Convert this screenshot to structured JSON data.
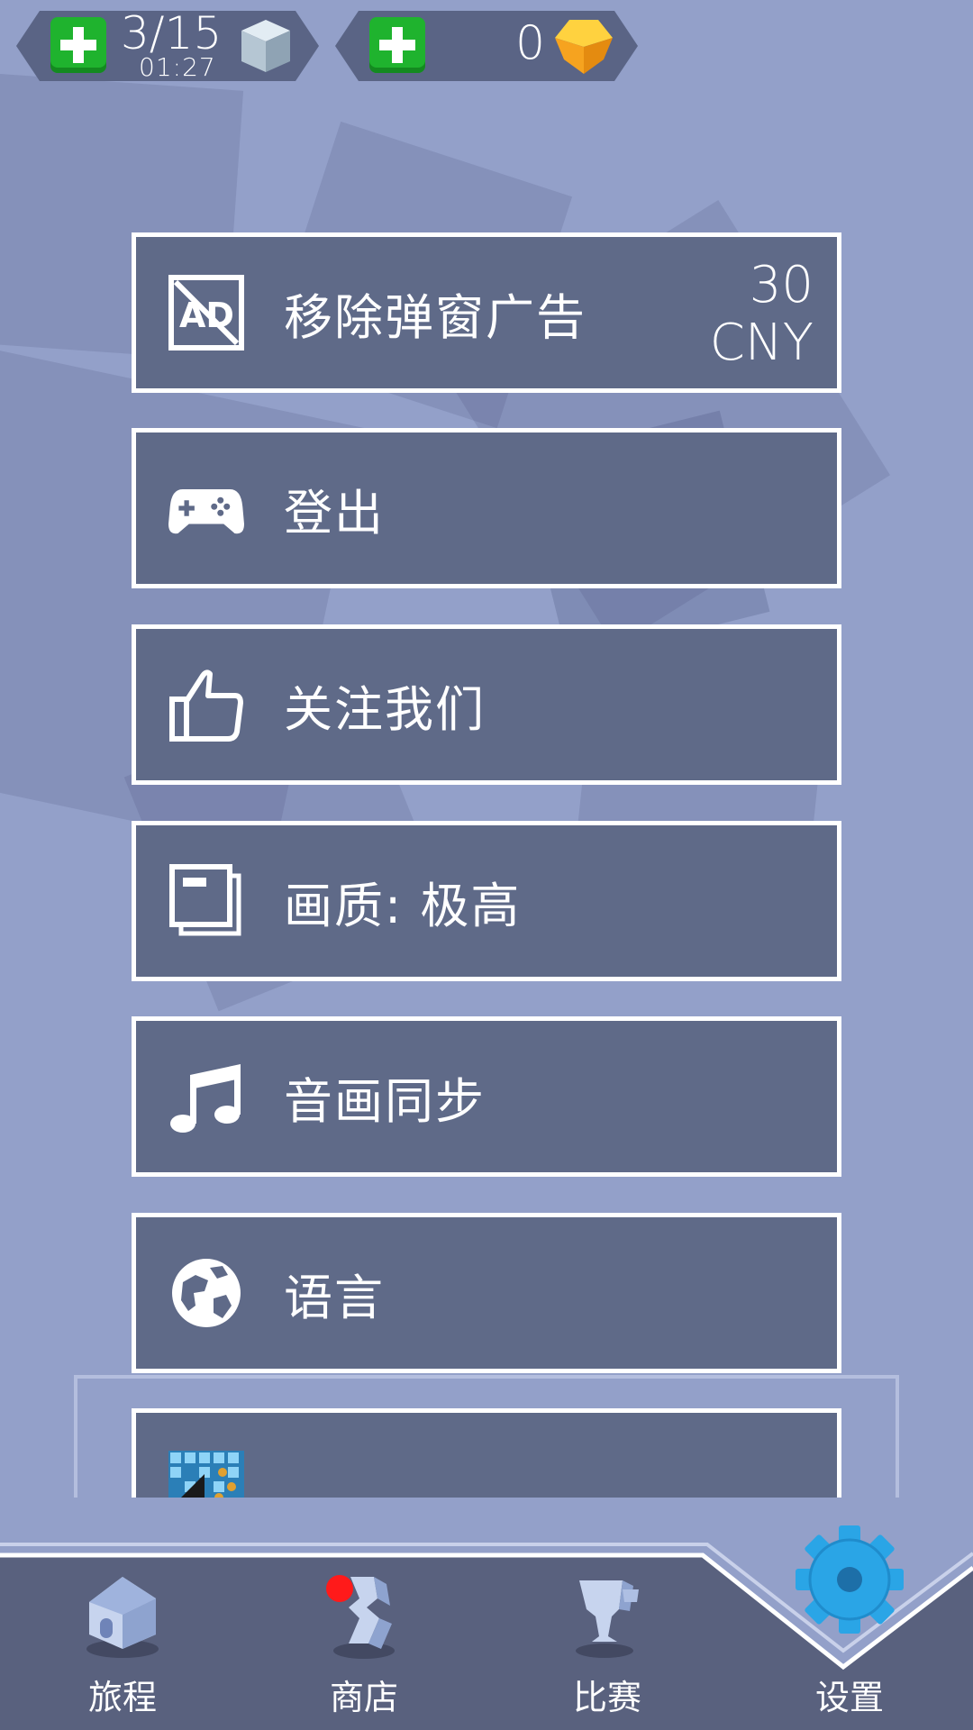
{
  "topbar": {
    "lives": {
      "count": "3/15",
      "timer": "01:27"
    },
    "gems": {
      "count": "0"
    }
  },
  "menu": {
    "remove_ads": {
      "label": "移除弹窗广告",
      "price_amount": "30",
      "price_currency": "CNY",
      "icon": "no-ads-icon"
    },
    "logout": {
      "label": "登出",
      "icon": "gamepad-icon"
    },
    "follow": {
      "label": "关注我们",
      "icon": "thumbs-up-icon"
    },
    "quality": {
      "label": "画质: 极高",
      "icon": "graphics-quality-icon"
    },
    "sync": {
      "label": "音画同步",
      "icon": "music-note-icon"
    },
    "language": {
      "label": "语言",
      "icon": "globe-icon"
    }
  },
  "nav": {
    "journey": "旅程",
    "shop": "商店",
    "contest": "比赛",
    "settings": "设置"
  },
  "colors": {
    "background": "#93a0c9",
    "panel": "#5f6a88",
    "nav": "#59617e",
    "green": "#1fb32e",
    "gear": "#2aa5e6",
    "gem": "#f6b22a"
  }
}
